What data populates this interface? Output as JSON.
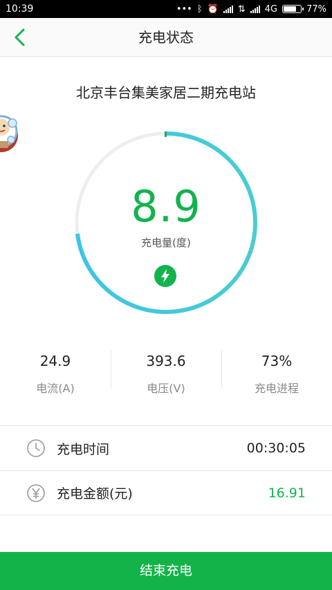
{
  "status_bar": {
    "time": "10:39",
    "network": "4G",
    "battery": "77%",
    "battery_level": 0.77
  },
  "header": {
    "title": "充电状态"
  },
  "station": {
    "name": "北京丰台集美家居二期充电站"
  },
  "gauge": {
    "value": "8.9",
    "label": "充电量(度)",
    "progress": 0.73,
    "track_color": "#eeeeee",
    "gradient_start": "#3cc4e8",
    "gradient_end": "#49cdd0"
  },
  "stats": [
    {
      "value": "24.9",
      "label": "电流(A)"
    },
    {
      "value": "393.6",
      "label": "电压(V)"
    },
    {
      "value": "73%",
      "label": "充电进程"
    }
  ],
  "details": {
    "time": {
      "label": "充电时间",
      "value": "00:30:05"
    },
    "amount": {
      "label": "充电金额(元)",
      "value": "16.91"
    }
  },
  "actions": {
    "stop_label": "结束充电"
  },
  "colors": {
    "accent": "#12b34c",
    "button": "#14b34a"
  },
  "icons": {
    "back": "chevron-left-icon",
    "charge": "lightning-bolt-icon",
    "clock": "clock-icon",
    "yuan": "yuan-icon"
  }
}
